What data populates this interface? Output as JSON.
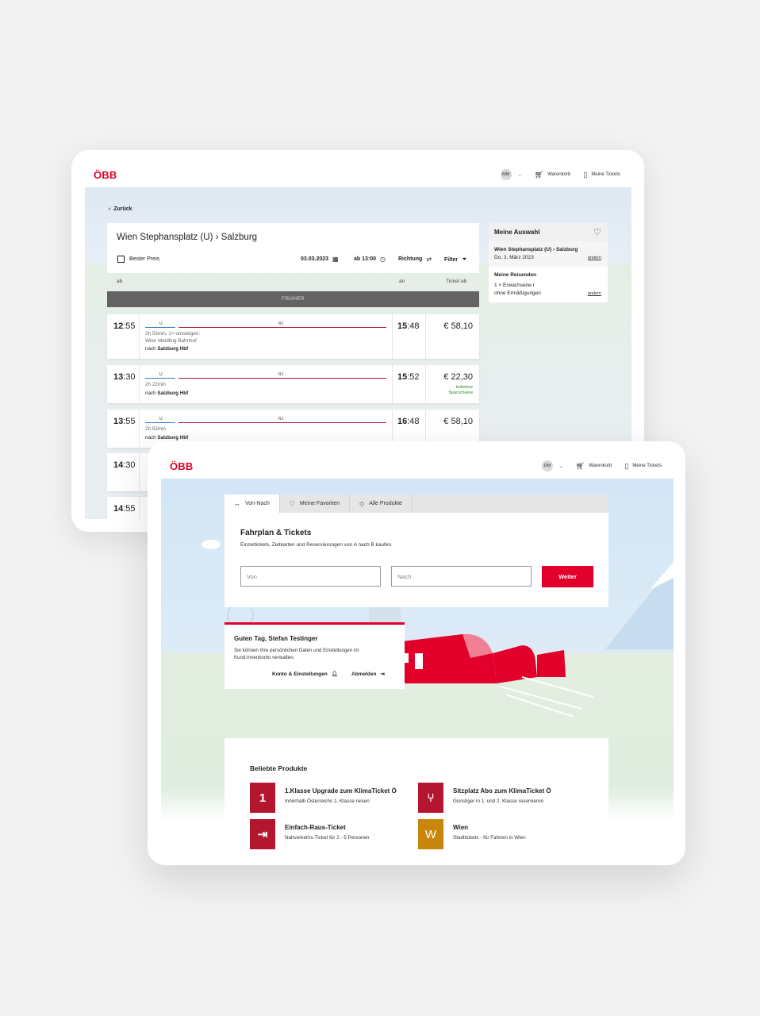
{
  "header": {
    "logo": "ÖBB",
    "avatar_back": "MM",
    "avatar_front": "DM",
    "cart": "Warenkorb",
    "tickets": "Meine Tickets"
  },
  "results": {
    "back": "Zurück",
    "route": "Wien Stephansplatz (U) › Salzburg",
    "best_price": "Bester Preis",
    "date": "03.03.2023",
    "time": "ab 13:00",
    "direction": "Richtung",
    "filter": "Filter",
    "col_from": "ab",
    "col_to": "an",
    "col_ticket": "Ticket ab",
    "earlier": "FRÜHER",
    "connections": [
      {
        "dep_h": "12",
        "dep_m": ":55",
        "u": "U",
        "rj": "RJ",
        "info1": "2h 53min, 1× umsteigen:",
        "info2": "Wien Meidling Bahnhof",
        "dest_pre": "nach ",
        "dest": "Salzburg Hbf",
        "arr_h": "15",
        "arr_m": ":48",
        "price": "€ 58,10",
        "note1": "",
        "note2": ""
      },
      {
        "dep_h": "13",
        "dep_m": ":30",
        "u": "U",
        "rj": "RJ",
        "info1": "2h 22min",
        "info2": "",
        "dest_pre": "nach ",
        "dest": "Salzburg Hbf",
        "arr_h": "15",
        "arr_m": ":52",
        "price": "€ 22,30",
        "note1": "teilweise",
        "note2": "Sparschiene"
      },
      {
        "dep_h": "13",
        "dep_m": ":55",
        "u": "U",
        "rj": "RJ",
        "info1": "2h 53min",
        "info2": "",
        "dest_pre": "nach ",
        "dest": "Salzburg Hbf",
        "arr_h": "16",
        "arr_m": ":48",
        "price": "€ 58,10",
        "note1": "",
        "note2": ""
      },
      {
        "dep_h": "14",
        "dep_m": ":30"
      },
      {
        "dep_h": "14",
        "dep_m": ":55"
      }
    ],
    "side": {
      "title": "Meine Auswahl",
      "route": "Wien Stephansplatz (U) › Salzburg",
      "date": "Do, 3. März 2023",
      "change": "ändern",
      "travellers_title": "Meine Reisenden",
      "travellers_1": "1 × Erwachsene:r",
      "travellers_2": "ohne Ermäßigungen"
    }
  },
  "home": {
    "tabs": [
      {
        "label": "Von-Nach",
        "icon": "arrows-icon"
      },
      {
        "label": "Meine Favoriten",
        "icon": "heart-icon"
      },
      {
        "label": "Alle Produkte",
        "icon": "tag-icon"
      }
    ],
    "planner_title": "Fahrplan & Tickets",
    "planner_sub": "Einzeltickets, Zeitkarten und Reservierungen von A nach B kaufen.",
    "from_placeholder": "Von",
    "to_placeholder": "Nach",
    "submit": "Weiter",
    "greet_title": "Guten Tag, Stefan Testinger",
    "greet_text": "Sie können Ihre persönlichen Daten und Einstellungen im Kund:innenkonto verwalten.",
    "account": "Konto & Einstellungen",
    "logout": "Abmelden",
    "products_title": "Beliebte Produkte",
    "products": [
      {
        "tile": "1",
        "name": "1.Klasse Upgrade zum KlimaTicket Ö",
        "desc": "Innerhalb Österreichs 1. Klasse reisen",
        "color": "#b3162e"
      },
      {
        "tile": "⑂",
        "name": "Sitzplatz Abo zum KlimaTicket Ö",
        "desc": "Günstiger in 1. und 2. Klasse reservieren",
        "color": "#b3162e"
      },
      {
        "tile": "⇥",
        "name": "Einfach-Raus-Ticket",
        "desc": "Nahverkehrs-Ticket für 2 - 5 Personen",
        "color": "#b3162e"
      },
      {
        "tile": "W",
        "name": "Wien",
        "desc": "Stadttickets - für Fahrten in Wien",
        "color": "#c8860a"
      }
    ]
  }
}
